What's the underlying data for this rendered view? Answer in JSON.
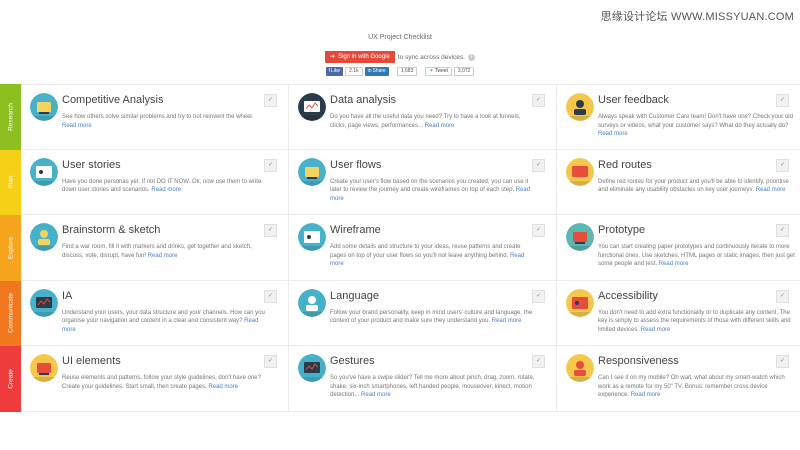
{
  "watermark": "思缘设计论坛 WWW.MISSYUAN.COM",
  "header": {
    "title": "UX Project Checklist",
    "signin_label": "Sign in with Google",
    "sync_text": "to sync across devices.",
    "info_icon": "info-icon",
    "share": {
      "facebook_label": "Like",
      "facebook_count": "2.1k",
      "linkedin_label": "Share",
      "linkedin_count": "1,683",
      "twitter_label": "Tweet",
      "twitter_count": "3,072"
    }
  },
  "check_icon": "✓",
  "phases": [
    {
      "label": "Research",
      "color": "#8cbf1f"
    },
    {
      "label": "Plan",
      "color": "#f6cf17"
    },
    {
      "label": "Explore",
      "color": "#f7a51e"
    },
    {
      "label": "Communicate",
      "color": "#f1781f"
    },
    {
      "label": "Create",
      "color": "#ee3b3b"
    }
  ],
  "read_more": "Read more",
  "rows": [
    [
      {
        "title": "Competitive Analysis",
        "desc": "See how others solve similar problems and try to not reinvent the wheel.",
        "icon": "competitive-analysis-icon",
        "bg": "#47b1c9",
        "fg": "#f4d35e"
      },
      {
        "title": "Data analysis",
        "desc": "Do you have all the useful data you need? Try to have a look at funnels, clicks, page views, performances...",
        "icon": "data-analysis-icon",
        "bg": "#2b3b49",
        "fg": "#ffffff"
      },
      {
        "title": "User feedback",
        "desc": "Always speak with Customer Care team! Don't have one? Check your old surveys or videos, what your customer says? What do they actually do?",
        "icon": "user-feedback-icon",
        "bg": "#f5c84c",
        "fg": "#2b3b49"
      }
    ],
    [
      {
        "title": "User stories",
        "desc": "Have you done personas yet. If not DO IT NOW. Ok, now use them to write down user stories and scenarios.",
        "icon": "user-stories-icon",
        "bg": "#47b1c9",
        "fg": "#ffffff"
      },
      {
        "title": "User flows",
        "desc": "Create your user's flow based on the scenarios you created, you can use it later to review the journey and create wireframes on top of each step.",
        "icon": "user-flows-icon",
        "bg": "#47b1c9",
        "fg": "#f4d35e"
      },
      {
        "title": "Red routes",
        "desc": "Define red routes for your product and you'll be able to identify, prioritise and eliminate any usability obstacles on key user journeys.",
        "icon": "red-routes-icon",
        "bg": "#f5c84c",
        "fg": "#e74c3c"
      }
    ],
    [
      {
        "title": "Brainstorm & sketch",
        "desc": "Find a war room, fill it with markers and drinks, get together and sketch, discuss, vote, disrupt, have fun!",
        "icon": "brainstorm-icon",
        "bg": "#47b1c9",
        "fg": "#f4d35e"
      },
      {
        "title": "Wireframe",
        "desc": "Add some details and structure to your ideas, reuse patterns and create pages on top of your user flows so you'll not leave anything behind.",
        "icon": "wireframe-icon",
        "bg": "#47b1c9",
        "fg": "#ffffff"
      },
      {
        "title": "Prototype",
        "desc": "You can start creating paper prototypes and continuously iterate to more functional ones. Use sketches, HTML pages or static images, then just get some people and test.",
        "icon": "prototype-icon",
        "bg": "#5ab7b1",
        "fg": "#e74c3c"
      }
    ],
    [
      {
        "title": "IA",
        "desc": "Understand your users, your data structure and your channels. How can you organise your navigation and content in a clear and consistent way?",
        "icon": "ia-icon",
        "bg": "#47b1c9",
        "fg": "#2b3b49"
      },
      {
        "title": "Language",
        "desc": "Follow your brand personality, keep in mind users' culture and language, the context of your product and make sure they understand you.",
        "icon": "language-icon",
        "bg": "#47b1c9",
        "fg": "#ffffff"
      },
      {
        "title": "Accessibility",
        "desc": "You don't need to add extra functionality or to duplicate any content. The key is simply to assess the requirements of those with different skills and limited devices.",
        "icon": "accessibility-icon",
        "bg": "#f5c84c",
        "fg": "#e74c3c"
      }
    ],
    [
      {
        "title": "UI elements",
        "desc": "Reuse elements and patterns, follow your style guidelines, don't have one? Create your guidelines. Start small, then create pages.",
        "icon": "ui-elements-icon",
        "bg": "#f5c84c",
        "fg": "#e74c3c"
      },
      {
        "title": "Gestures",
        "desc": "So you've have a swipe slider? Tell me more about pinch, drag, zoom, rotate, shake, six-inch smartphones, left handed people, mouseover, kinect, motion detection...",
        "icon": "gestures-icon",
        "bg": "#47b1c9",
        "fg": "#2b3b49"
      },
      {
        "title": "Responsiveness",
        "desc": "Can I see it on my mobile? Oh wait, what about my smart-watch which work as a remote for my 50\" TV. Bonus: remember cross device experience.",
        "icon": "responsiveness-icon",
        "bg": "#f5c84c",
        "fg": "#e74c3c"
      }
    ]
  ]
}
